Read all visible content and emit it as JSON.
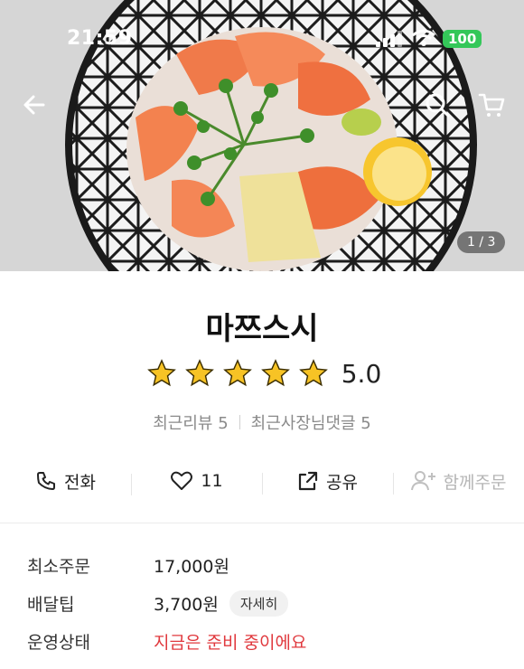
{
  "status_bar": {
    "time": "21:59",
    "battery": "100"
  },
  "header": {
    "image_counter": "1 / 3"
  },
  "store": {
    "name": "마쯔스시",
    "rating": "5.0",
    "rating_stars": 5,
    "recent_reviews": "최근리뷰 5",
    "owner_comments": "최근사장님댓글 5"
  },
  "actions": {
    "call": "전화",
    "likes": "11",
    "share": "공유",
    "group_order": "함께주문"
  },
  "info": {
    "min_order_label": "최소주문",
    "min_order_value": "17,000원",
    "delivery_tip_label": "배달팁",
    "delivery_tip_value": "3,700원",
    "detail_label": "자세히",
    "status_label": "운영상태",
    "status_value": "지금은 준비 중이에요"
  },
  "colors": {
    "star": "#f7c325",
    "status": "#e0393e",
    "battery": "#34c759"
  }
}
